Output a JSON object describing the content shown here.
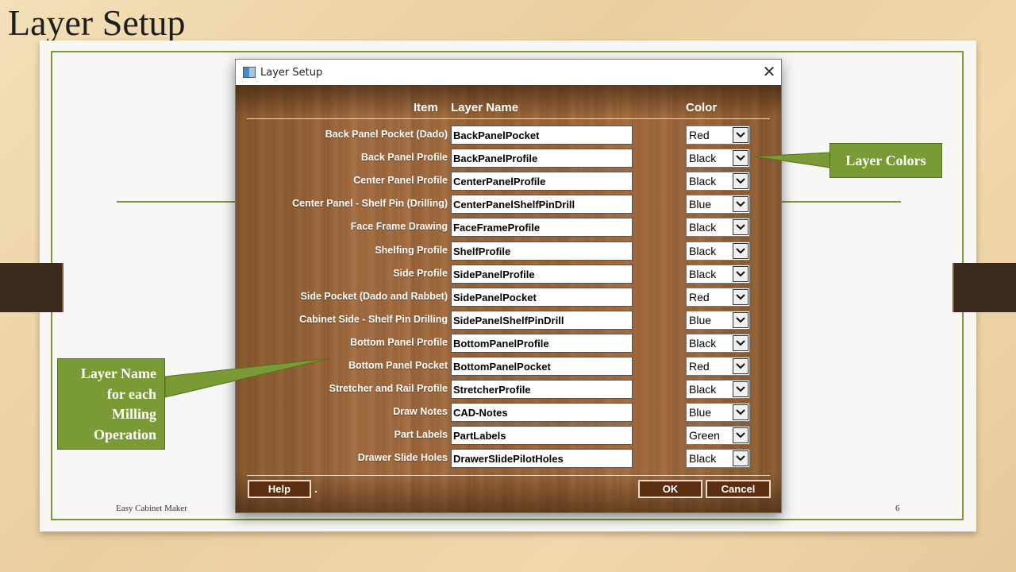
{
  "slide": {
    "title": "Layer Setup",
    "footer_left": "Easy Cabinet Maker",
    "page_number": "6"
  },
  "dialog": {
    "title": "Layer Setup",
    "close_icon": "close-icon",
    "headers": {
      "item": "Item",
      "layer_name": "Layer Name",
      "color": "Color"
    },
    "rows": [
      {
        "label": "Back Panel Pocket (Dado)",
        "layer": "BackPanelPocket",
        "color": "Red"
      },
      {
        "label": "Back Panel Profile",
        "layer": "BackPanelProfile",
        "color": "Black"
      },
      {
        "label": "Center Panel Profile",
        "layer": "CenterPanelProfile",
        "color": "Black"
      },
      {
        "label": "Center Panel - Shelf Pin (Drilling)",
        "layer": "CenterPanelShelfPinDrill",
        "color": "Blue"
      },
      {
        "label": "Face Frame Drawing",
        "layer": "FaceFrameProfile",
        "color": "Black"
      },
      {
        "label": "Shelfing Profile",
        "layer": "ShelfProfile",
        "color": "Black"
      },
      {
        "label": "Side Profile",
        "layer": "SidePanelProfile",
        "color": "Black"
      },
      {
        "label": "Side Pocket (Dado and Rabbet)",
        "layer": "SidePanelPocket",
        "color": "Red"
      },
      {
        "label": "Cabinet Side - Shelf Pin Drilling",
        "layer": "SidePanelShelfPinDrill",
        "color": "Blue"
      },
      {
        "label": "Bottom Panel Profile",
        "layer": "BottomPanelProfile",
        "color": "Black"
      },
      {
        "label": "Bottom Panel Pocket",
        "layer": "BottomPanelPocket",
        "color": "Red"
      },
      {
        "label": "Stretcher and Rail Profile",
        "layer": "StretcherProfile",
        "color": "Black"
      },
      {
        "label": "Draw Notes",
        "layer": "CAD-Notes",
        "color": "Blue"
      },
      {
        "label": "Part Labels",
        "layer": "PartLabels",
        "color": "Green"
      },
      {
        "label": "Drawer Slide Holes",
        "layer": "DrawerSlidePilotHoles",
        "color": "Black"
      }
    ],
    "buttons": {
      "help": "Help",
      "dot": ".",
      "ok": "OK",
      "cancel": "Cancel"
    }
  },
  "callouts": {
    "layer_colors": "Layer Colors",
    "layer_name_lines": [
      "Layer Name",
      "for each",
      "Milling",
      "Operation"
    ]
  }
}
